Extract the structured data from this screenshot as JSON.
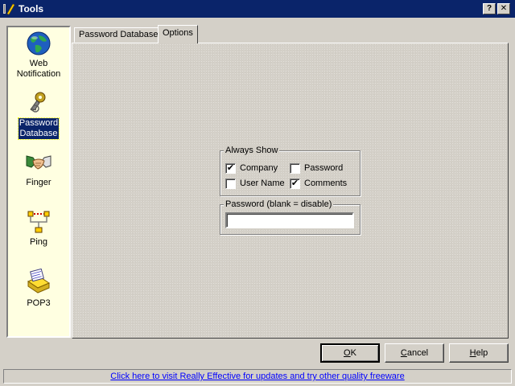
{
  "window": {
    "title": "Tools",
    "help_glyph": "?",
    "close_glyph": "✕",
    "title_icon": "tools-icon"
  },
  "sidebar": {
    "items": [
      {
        "label_line1": "Web",
        "label_line2": "Notification",
        "icon": "globe-icon",
        "selected": false
      },
      {
        "label_line1": "Password",
        "label_line2": "Database",
        "icon": "key-icon",
        "selected": true
      },
      {
        "label_line1": "Finger",
        "label_line2": "",
        "icon": "handshake-icon",
        "selected": false
      },
      {
        "label_line1": "Ping",
        "label_line2": "",
        "icon": "network-icon",
        "selected": false
      },
      {
        "label_line1": "POP3",
        "label_line2": "",
        "icon": "mail-icon",
        "selected": false
      }
    ]
  },
  "tabs": [
    {
      "label": "Password Database",
      "active": false
    },
    {
      "label": "Options",
      "active": true
    }
  ],
  "options": {
    "always_show": {
      "title": "Always Show",
      "checkboxes": [
        {
          "label": "Company",
          "checked": true,
          "mark": "✔"
        },
        {
          "label": "Password",
          "checked": false,
          "mark": ""
        },
        {
          "label": "User Name",
          "checked": false,
          "mark": ""
        },
        {
          "label": "Comments",
          "checked": true,
          "mark": "✔"
        }
      ]
    },
    "password_group": {
      "title": "Password (blank = disable)",
      "value": ""
    }
  },
  "buttons": {
    "ok_hotkey": "O",
    "ok_rest": "K",
    "cancel_hotkey": "C",
    "cancel_rest": "ancel",
    "help_hotkey": "H",
    "help_rest": "elp"
  },
  "status": {
    "link_text": "Click here to visit Really Effective for updates and try other quality freeware"
  },
  "colors": {
    "titlebar": "#0a246a",
    "face": "#d4d0c8",
    "sidebar_bg": "#ffffe1",
    "link": "#0000ff"
  }
}
